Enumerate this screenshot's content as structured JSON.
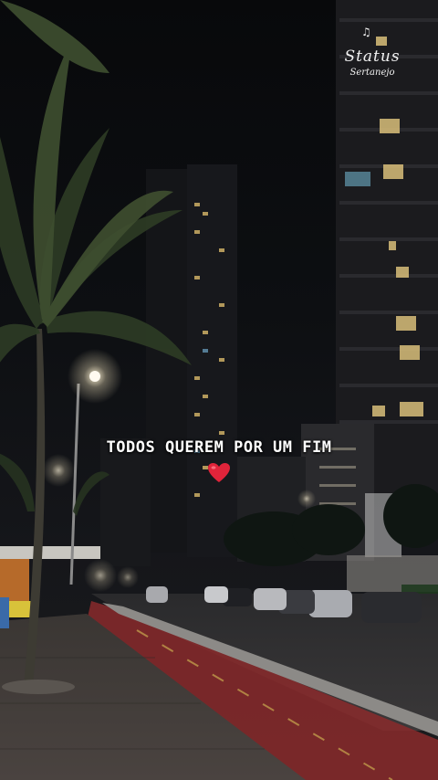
{
  "overlay": {
    "caption": "TODOS QUEREM POR UM FIM",
    "emoji": "red-heart-icon"
  },
  "watermark": {
    "title": "Status",
    "subtitle": "Sertanejo"
  },
  "colors": {
    "heart": "#e0243a",
    "bike_lane": "#9a2a2a",
    "streetlight": "#fff6dc"
  }
}
